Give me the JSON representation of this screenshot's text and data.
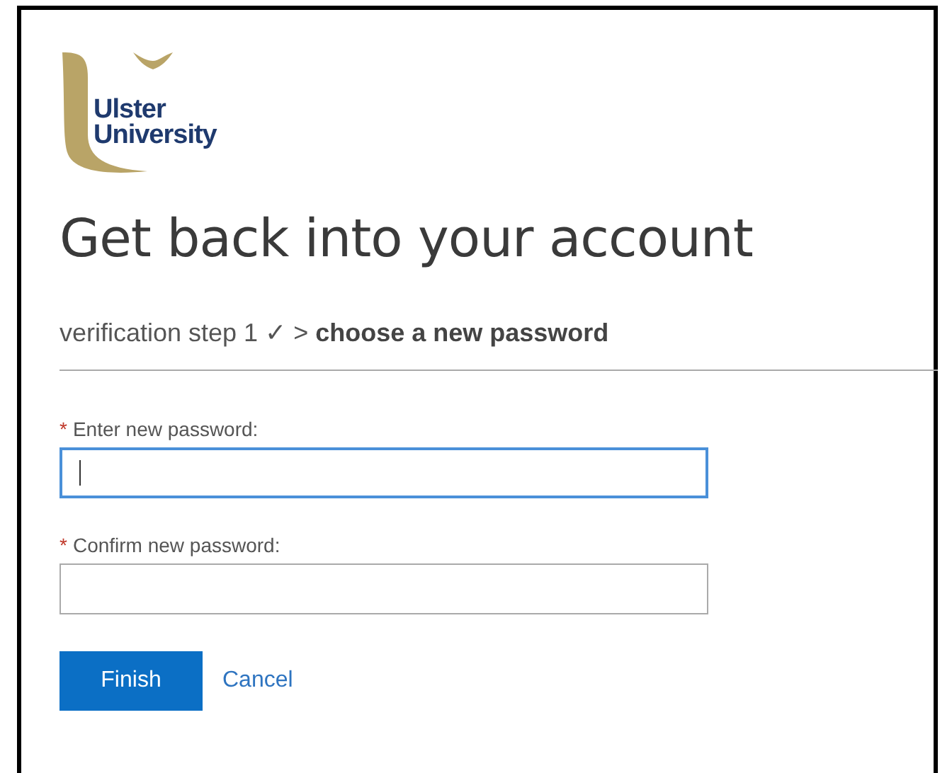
{
  "logo": {
    "text_lines": [
      "Ulster",
      "University"
    ]
  },
  "title": "Get back into your account",
  "breadcrumb": "verification step 1 ✓ > **choose a new password**",
  "fields": [
    {
      "required_mark": "*",
      "label": "Enter new password:",
      "focused": true
    },
    {
      "required_mark": "*",
      "label": "Confirm new password:",
      "focused": false
    }
  ],
  "buttons": [
    {
      "label": "Finish",
      "kind": "primary"
    },
    {
      "label": "Cancel",
      "kind": "link"
    }
  ]
}
